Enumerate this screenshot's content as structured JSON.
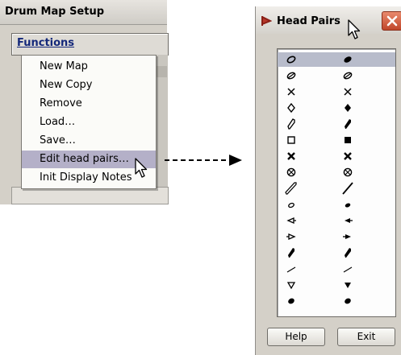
{
  "drum_map": {
    "title": "Drum Map Setup",
    "functions_label": "Functions",
    "menu": [
      {
        "label": "New Map"
      },
      {
        "label": "New Copy"
      },
      {
        "label": "Remove"
      },
      {
        "label": "Load…"
      },
      {
        "label": "Save…"
      },
      {
        "label": "Edit head pairs…",
        "selected": true
      },
      {
        "label": "Init Display Notes"
      }
    ]
  },
  "head_pairs": {
    "title": "Head Pairs",
    "rows": [
      {
        "left": "open-oval",
        "right": "filled-oval",
        "selected": true
      },
      {
        "left": "slashed-oval",
        "right": "slashed-oval"
      },
      {
        "left": "x",
        "right": "x"
      },
      {
        "left": "open-diamond",
        "right": "filled-diamond"
      },
      {
        "left": "open-slash-note",
        "right": "filled-slash-note"
      },
      {
        "left": "open-square",
        "right": "filled-square"
      },
      {
        "left": "bold-x",
        "right": "bold-x"
      },
      {
        "left": "circle-x",
        "right": "circle-x"
      },
      {
        "left": "open-long-slash",
        "right": "thin-long-slash"
      },
      {
        "left": "small-open-oval",
        "right": "small-filled-oval"
      },
      {
        "left": "open-left-triangle",
        "right": "filled-left-triangle"
      },
      {
        "left": "open-right-triangle",
        "right": "filled-right-triangle"
      },
      {
        "left": "thick-slash",
        "right": "thick-slash"
      },
      {
        "left": "thin-mark",
        "right": "thin-mark"
      },
      {
        "left": "open-down-triangle",
        "right": "filled-down-triangle"
      },
      {
        "left": "filled-oval",
        "right": "filled-oval"
      }
    ],
    "help_label": "Help",
    "exit_label": "Exit",
    "accent_color": "#c0462a"
  }
}
